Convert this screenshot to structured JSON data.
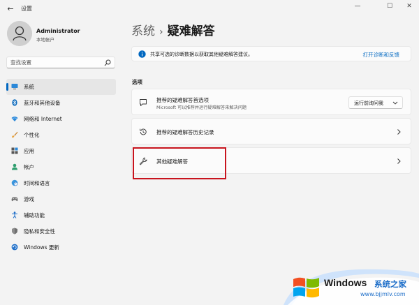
{
  "window": {
    "app_title": "设置",
    "back_glyph": "←",
    "minimize_glyph": "—",
    "maximize_glyph": "☐",
    "close_glyph": "✕"
  },
  "user": {
    "name": "Administrator",
    "account_type": "本地帐户"
  },
  "search": {
    "placeholder": "查找设置"
  },
  "sidebar": {
    "accent": "#0067c0",
    "items": [
      {
        "label": "系统",
        "icon": "monitor-icon",
        "active": true
      },
      {
        "label": "蓝牙和其他设备",
        "icon": "bluetooth-icon",
        "active": false
      },
      {
        "label": "网络和 Internet",
        "icon": "wifi-icon",
        "active": false
      },
      {
        "label": "个性化",
        "icon": "brush-icon",
        "active": false
      },
      {
        "label": "应用",
        "icon": "apps-icon",
        "active": false
      },
      {
        "label": "帐户",
        "icon": "person-icon",
        "active": false
      },
      {
        "label": "时间和语言",
        "icon": "globe-clock-icon",
        "active": false
      },
      {
        "label": "游戏",
        "icon": "gamepad-icon",
        "active": false
      },
      {
        "label": "辅助功能",
        "icon": "accessibility-icon",
        "active": false
      },
      {
        "label": "隐私和安全性",
        "icon": "shield-icon",
        "active": false
      },
      {
        "label": "Windows 更新",
        "icon": "update-icon",
        "active": false
      }
    ]
  },
  "breadcrumb": {
    "parent": "系统",
    "separator": "›",
    "current": "疑难解答"
  },
  "info_banner": {
    "text": "共享可选的诊断数据以获取其他疑难解答建议。",
    "link": "打开诊断和反馈",
    "icon": "info-icon"
  },
  "section": {
    "label": "选项"
  },
  "cards": {
    "recommended_prefs": {
      "title": "推荐的疑难解答首选项",
      "subtitle": "Microsoft 可以推荐并运行疑难解答来解决问题",
      "dropdown_value": "运行前询问我",
      "icon": "chat-icon"
    },
    "history": {
      "title": "推荐的疑难解答历史记录",
      "icon": "history-icon"
    },
    "other": {
      "title": "其他疑难解答",
      "icon": "wrench-icon",
      "highlight_color": "#c8141e"
    }
  },
  "watermark": {
    "brand": "Windows",
    "cn_name": "系统之家",
    "url": "www.bjjmlv.com"
  }
}
